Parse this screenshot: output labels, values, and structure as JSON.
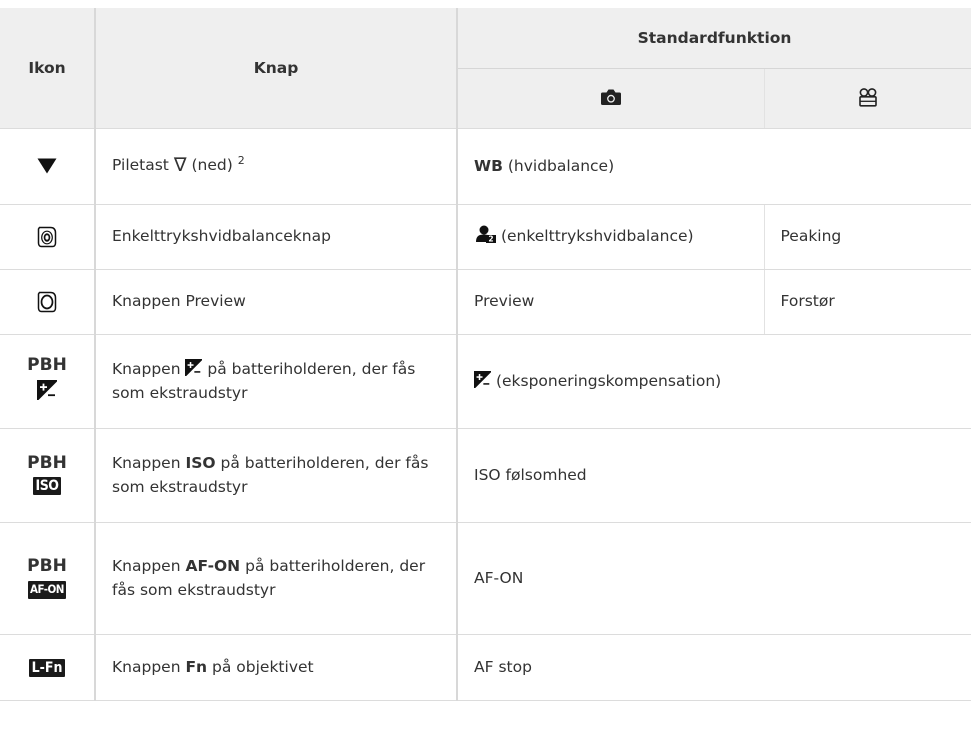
{
  "header": {
    "col_icon": "Ikon",
    "col_button": "Knap",
    "col_default": "Standardfunktion",
    "sub_photo_icon": "camera-icon",
    "sub_movie_icon": "movie-camera-icon"
  },
  "rows": [
    {
      "icon": "down-triangle-icon",
      "button_text": "Piletast",
      "button_arrow": "∇",
      "button_tail": "(ned)",
      "button_sup": "2",
      "photo_bold": "WB",
      "photo_text": "(hvidbalance)"
    },
    {
      "icon": "one-touch-wb-button-icon",
      "button_text": "Enkelttrykshvidbalanceknap",
      "photo_icon": "one-touch-wb-icon",
      "photo_text": "(enkelttrykshvidbalance)",
      "movie_text": "Peaking"
    },
    {
      "icon": "preview-button-icon",
      "button_text": "Knappen Preview",
      "photo_text": "Preview",
      "movie_text": "Forstør"
    },
    {
      "icon_label": "PBH",
      "icon": "exposure-comp-icon",
      "button_pre": "Knappen",
      "button_post": "på batteriholderen, der fås som ekstraudstyr",
      "photo_text": "(eksponeringskompensation)"
    },
    {
      "icon_label": "PBH",
      "icon_badge": "ISO",
      "button_pre": "Knappen",
      "button_bold": "ISO",
      "button_post": "på batteriholderen, der fås som ekstraudstyr",
      "photo_text": "ISO følsomhed"
    },
    {
      "icon_label": "PBH",
      "icon_badge": "AF-ON",
      "button_pre": "Knappen",
      "button_bold": "AF-ON",
      "button_post": "på batteriholderen, der fås som ekstraudstyr",
      "photo_text": "AF-ON"
    },
    {
      "icon_badge": "L-Fn",
      "button_pre": "Knappen",
      "button_bold": "Fn",
      "button_post": "på objektivet",
      "photo_text": "AF stop"
    }
  ]
}
